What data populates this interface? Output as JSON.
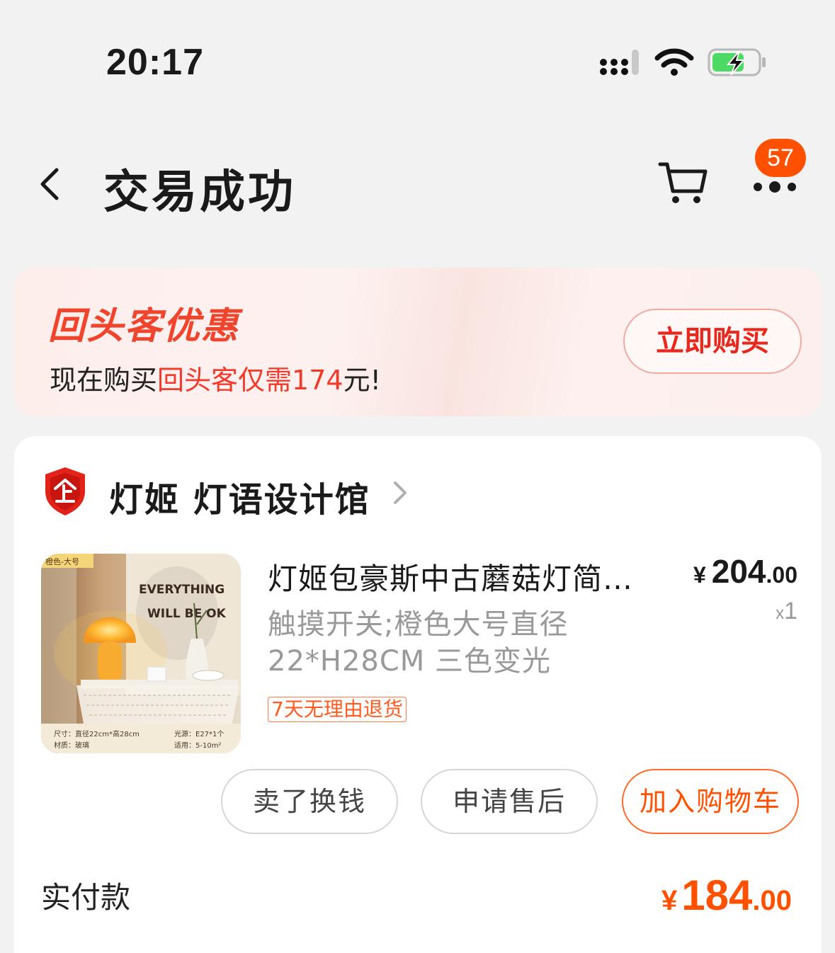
{
  "status_bar": {
    "time": "20:17"
  },
  "nav": {
    "title": "交易成功",
    "badge_count": "57"
  },
  "promo": {
    "title": "回头客优惠",
    "text_prefix": "现在购买",
    "text_highlight": "回头客仅需",
    "price": "174",
    "text_suffix": "元!",
    "buy_button": "立即购买"
  },
  "order": {
    "shop_name": "灯姬 灯语设计馆",
    "product": {
      "title": "灯姬包豪斯中古蘑菇灯简约卧室床头台灯",
      "sku": "触摸开关;橙色大号直径 22*H28CM 三色变光",
      "tag": "7天无理由退货",
      "price_currency": "¥",
      "price_int": "204",
      "price_dec": ".00",
      "qty_prefix": "x",
      "qty": "1",
      "image": {
        "corner_label": "橙色-大号",
        "wall_text_1": "EVERYTHING",
        "wall_text_2": "WILL BE OK",
        "spec_size": "尺寸：直径22cm*高28cm",
        "spec_material": "材质：玻璃",
        "spec_light": "光源：E27*1个",
        "spec_area": "适用：5-10m²"
      }
    },
    "actions": {
      "sell": "卖了换钱",
      "after_sale": "申请售后",
      "add_cart": "加入购物车"
    },
    "paid_label": "实付款",
    "paid_currency": "¥",
    "paid_int": "184",
    "paid_dec": ".00"
  },
  "colors": {
    "accent": "#ff5000",
    "promo_red": "#f0442c",
    "background": "#f2f2f2"
  }
}
